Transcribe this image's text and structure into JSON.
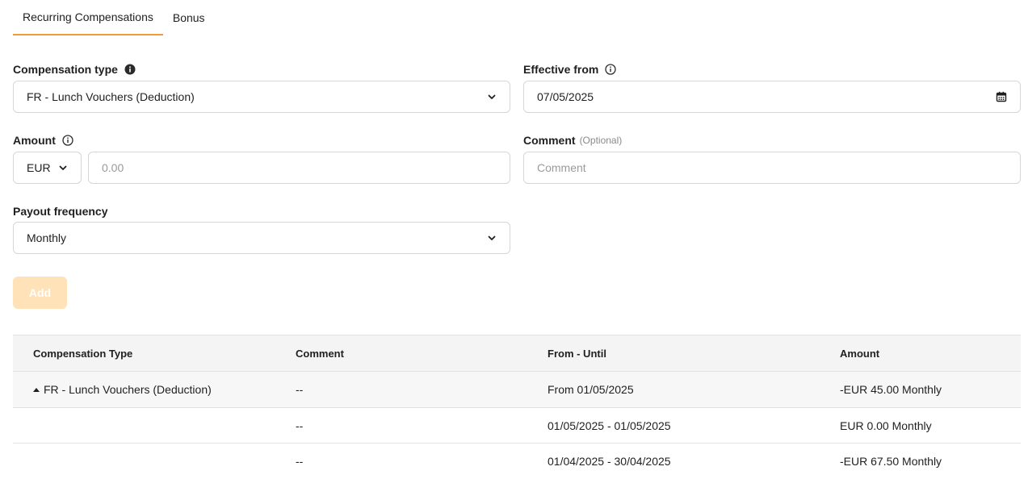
{
  "tabs": [
    {
      "label": "Recurring Compensations",
      "active": true
    },
    {
      "label": "Bonus",
      "active": false
    }
  ],
  "form": {
    "compensation_type": {
      "label": "Compensation type",
      "value": "FR - Lunch Vouchers (Deduction)",
      "icon": "info-filled-icon"
    },
    "effective_from": {
      "label": "Effective from",
      "value": "07/05/2025",
      "icon": "info-outline-icon"
    },
    "amount": {
      "label": "Amount",
      "currency": "EUR",
      "placeholder": "0.00",
      "icon": "info-outline-icon"
    },
    "comment": {
      "label": "Comment",
      "optional": "(Optional)",
      "placeholder": "Comment"
    },
    "payout_frequency": {
      "label": "Payout frequency",
      "value": "Monthly"
    },
    "add_label": "Add"
  },
  "table": {
    "headers": [
      "Compensation Type",
      "Comment",
      "From - Until",
      "Amount"
    ],
    "rows": [
      {
        "type": "FR - Lunch Vouchers (Deduction)",
        "comment": "--",
        "period": "From 01/05/2025",
        "amount": "-EUR 45.00 Monthly"
      },
      {
        "type": "",
        "comment": "--",
        "period": "01/05/2025 - 01/05/2025",
        "amount": "EUR 0.00 Monthly"
      },
      {
        "type": "",
        "comment": "--",
        "period": "01/04/2025 - 30/04/2025",
        "amount": "-EUR 67.50 Monthly"
      }
    ]
  },
  "colors": {
    "accent": "#f29d38",
    "add_button_disabled": "#ffe2b8"
  }
}
